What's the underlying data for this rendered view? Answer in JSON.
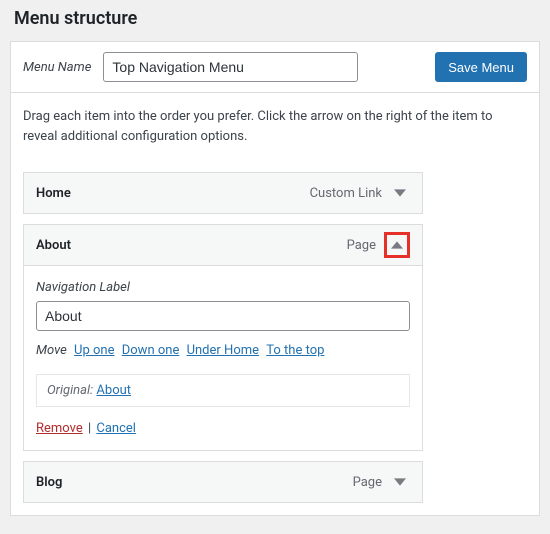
{
  "heading": "Menu structure",
  "menu_name": {
    "label": "Menu Name",
    "value": "Top Navigation Menu"
  },
  "save_label": "Save Menu",
  "instructions": "Drag each item into the order you prefer. Click the arrow on the right of the item to reveal additional configuration options.",
  "items": [
    {
      "title": "Home",
      "type": "Custom Link",
      "expanded": false
    },
    {
      "title": "About",
      "type": "Page",
      "expanded": true
    },
    {
      "title": "Blog",
      "type": "Page",
      "expanded": false
    }
  ],
  "about_settings": {
    "nav_label_title": "Navigation Label",
    "nav_label_value": "About",
    "move_label": "Move",
    "move_links": {
      "up": "Up one",
      "down": "Down one",
      "under": "Under Home",
      "top": "To the top"
    },
    "original_label": "Original:",
    "original_link": "About",
    "remove_label": "Remove",
    "cancel_label": "Cancel"
  }
}
